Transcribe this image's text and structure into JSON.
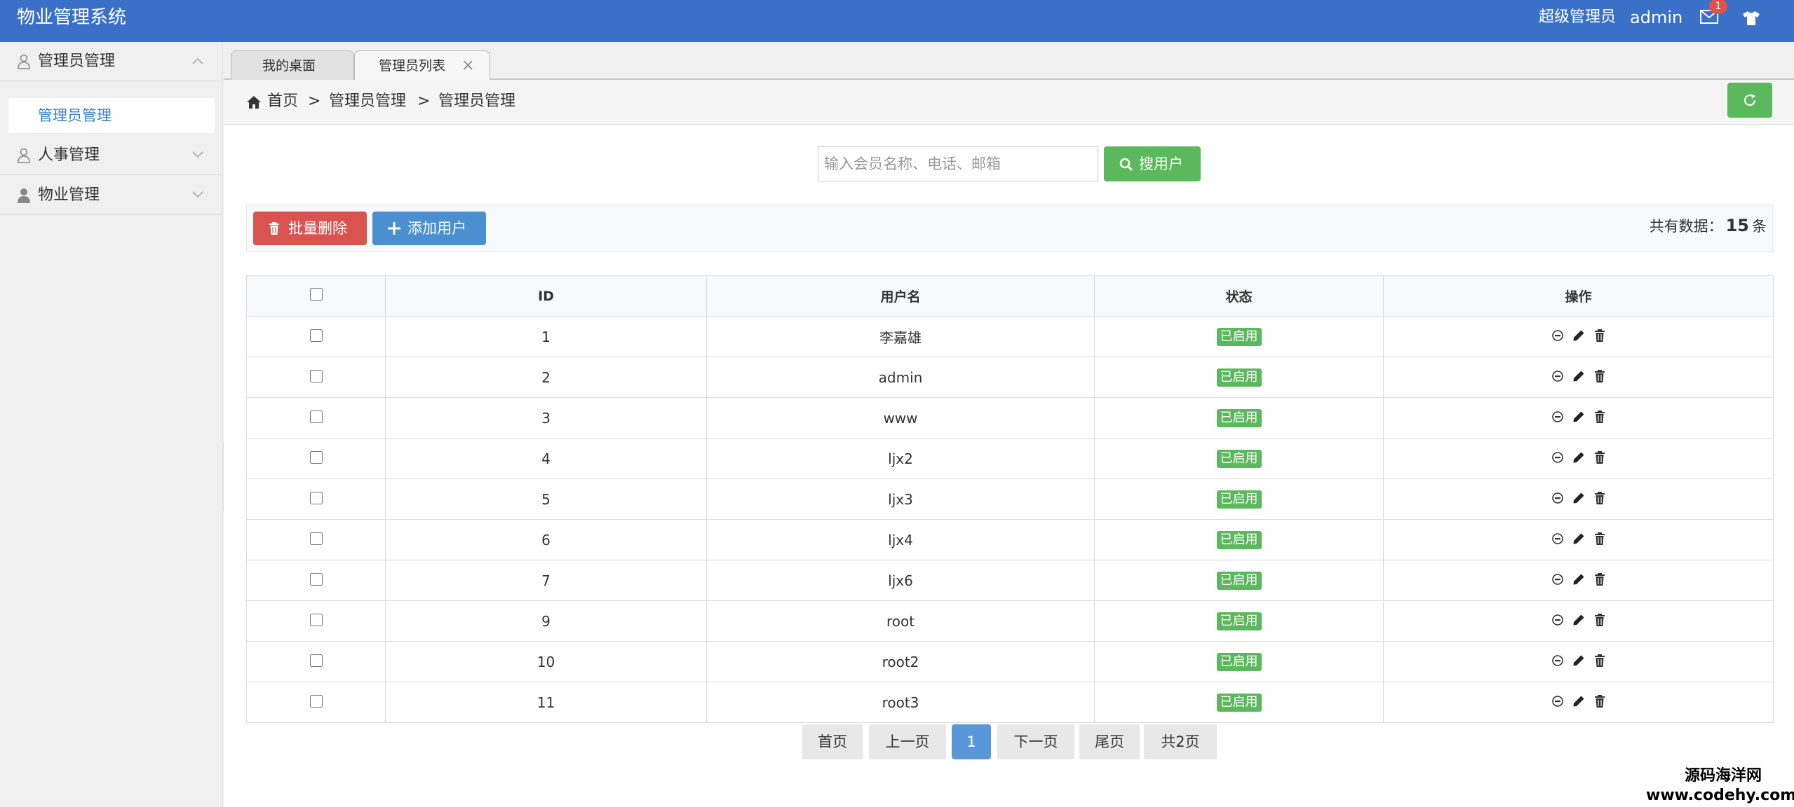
{
  "app": {
    "title": "物业管理系统",
    "user_role": "超级管理员",
    "user_name": "admin",
    "unread_count": "1"
  },
  "sidebar": {
    "groups": [
      {
        "label": "管理员管理",
        "icon": "user-outline-icon",
        "expanded": true,
        "items": [
          {
            "label": "管理员管理",
            "active": true
          }
        ]
      },
      {
        "label": "人事管理",
        "icon": "user-outline-icon",
        "expanded": false
      },
      {
        "label": "物业管理",
        "icon": "user-solid-icon",
        "expanded": false
      }
    ]
  },
  "tabs": [
    {
      "label": "我的桌面",
      "closable": false,
      "active": false
    },
    {
      "label": "管理员列表",
      "closable": true,
      "active": true
    }
  ],
  "breadcrumb": {
    "items": [
      "首页",
      "管理员管理",
      "管理员管理"
    ],
    "separator": ">"
  },
  "search": {
    "placeholder": "输入会员名称、电话、邮箱",
    "value": "",
    "button_label": "搜用户"
  },
  "toolbar": {
    "batch_delete_label": "批量删除",
    "add_user_label": "添加用户",
    "total_prefix": "共有数据：",
    "total_count": "15",
    "total_suffix": "条"
  },
  "table": {
    "columns": [
      "",
      "ID",
      "用户名",
      "状态",
      "操作"
    ],
    "rows": [
      {
        "id": "1",
        "username": "李嘉雄",
        "status": "已启用"
      },
      {
        "id": "2",
        "username": "admin",
        "status": "已启用"
      },
      {
        "id": "3",
        "username": "www",
        "status": "已启用"
      },
      {
        "id": "4",
        "username": "ljx2",
        "status": "已启用"
      },
      {
        "id": "5",
        "username": "ljx3",
        "status": "已启用"
      },
      {
        "id": "6",
        "username": "ljx4",
        "status": "已启用"
      },
      {
        "id": "7",
        "username": "ljx6",
        "status": "已启用"
      },
      {
        "id": "9",
        "username": "root",
        "status": "已启用"
      },
      {
        "id": "10",
        "username": "root2",
        "status": "已启用"
      },
      {
        "id": "11",
        "username": "root3",
        "status": "已启用"
      }
    ]
  },
  "pagination": {
    "first": "首页",
    "prev": "上一页",
    "current": "1",
    "next": "下一页",
    "last": "尾页",
    "total_pages": "共2页"
  },
  "watermark": {
    "line1": "源码海洋网",
    "line2": "www.codehy.com"
  },
  "colors": {
    "topbar": "#3b70c8",
    "success": "#5cb85c",
    "danger": "#d9534f",
    "primary": "#4a8fd0",
    "link": "#3c82c4"
  }
}
